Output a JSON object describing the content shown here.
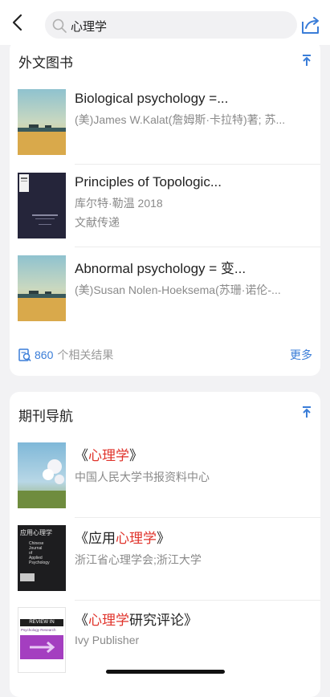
{
  "search": {
    "query": "心理学"
  },
  "foreign_books": {
    "title": "外文图书",
    "items": [
      {
        "title": "Biological psychology =...",
        "line1": "(美)James W.Kalat(詹姆斯·卡拉特)著; 苏...",
        "line2": ""
      },
      {
        "title": "Principles of Topologic...",
        "line1": "库尔特·勒温    2018",
        "line2": "文献传递"
      },
      {
        "title": "Abnormal psychology = 变...",
        "line1": "(美)Susan Nolen-Hoeksema(苏珊·诺伦-...",
        "line2": ""
      }
    ],
    "result_count": "860",
    "result_label": "个相关结果",
    "more_label": "更多"
  },
  "journals": {
    "title": "期刊导航",
    "items": [
      {
        "pre": "《",
        "hl": "心理学",
        "post": "》",
        "publisher": "中国人民大学书报资料中心"
      },
      {
        "pre": "《应用",
        "hl": "心理学",
        "post": "》",
        "publisher": "浙江省心理学会;浙江大学"
      },
      {
        "pre": "《",
        "hl": "心理学",
        "post": "研究评论》",
        "publisher": "Ivy Publisher"
      }
    ],
    "cover2": {
      "title_cn": "应用心理学",
      "title_en_1": "Chinese",
      "title_en_2": "Journal",
      "title_en_3": "of",
      "title_en_4": "Applied",
      "title_en_5": "Psychology"
    },
    "cover3": {
      "banner": "REVIEW IN",
      "subtitle": "Psychology Research"
    }
  },
  "colors": {
    "accent": "#3a7dd8",
    "highlight": "#e0332b"
  }
}
